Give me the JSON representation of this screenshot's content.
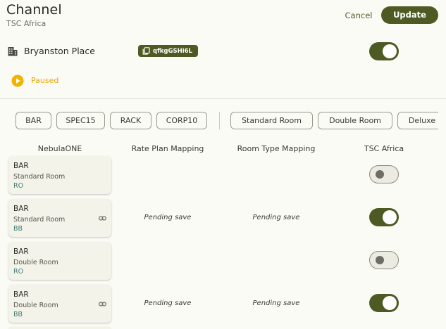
{
  "header": {
    "title": "Channel",
    "subtitle": "TSC Africa",
    "cancel_label": "Cancel",
    "update_label": "Update"
  },
  "property": {
    "icon": "building-icon",
    "name": "Bryanston Place",
    "code": "qfkgGSHi6L",
    "enabled": true
  },
  "status": {
    "icon": "pause-circle-icon",
    "label": "Paused",
    "color": "#e8a800"
  },
  "rate_filters": [
    "BAR",
    "SPEC15",
    "RACK",
    "CORP10"
  ],
  "room_filters": [
    "Standard Room",
    "Double Room",
    "Deluxe"
  ],
  "columns": [
    "NebulaONE",
    "Rate Plan Mapping",
    "Room Type Mapping",
    "TSC Africa"
  ],
  "rows": [
    {
      "rate": "BAR",
      "room": "Standard Room",
      "board": "RO",
      "linked": false,
      "rate_mapping": "",
      "room_mapping": "",
      "enabled": false
    },
    {
      "rate": "BAR",
      "room": "Standard Room",
      "board": "BB",
      "linked": true,
      "rate_mapping": "Pending save",
      "room_mapping": "Pending save",
      "enabled": true
    },
    {
      "rate": "BAR",
      "room": "Double Room",
      "board": "RO",
      "linked": false,
      "rate_mapping": "",
      "room_mapping": "",
      "enabled": false
    },
    {
      "rate": "BAR",
      "room": "Double Room",
      "board": "BB",
      "linked": true,
      "rate_mapping": "Pending save",
      "room_mapping": "Pending save",
      "enabled": true
    }
  ],
  "colors": {
    "accent": "#4e5a23",
    "background": "#fbfbf6",
    "card": "#f3f3ea",
    "board_text": "#3d7a7a"
  }
}
